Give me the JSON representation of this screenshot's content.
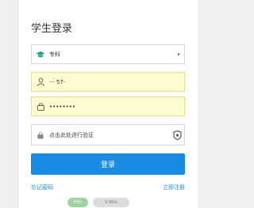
{
  "title": "学生登录",
  "level_select": {
    "value": "专科"
  },
  "account": {
    "value": "··· 57·"
  },
  "password": {
    "value": "••••••••"
  },
  "verify": {
    "label": "点击此处进行验证"
  },
  "login_button": "登录",
  "forgot_link": "忘记密码",
  "register_link": "立即注册",
  "footer_tags": [
    "49%",
    "0.5K/s"
  ],
  "colors": {
    "primary": "#1a8be3",
    "accent": "#1fa58b"
  }
}
